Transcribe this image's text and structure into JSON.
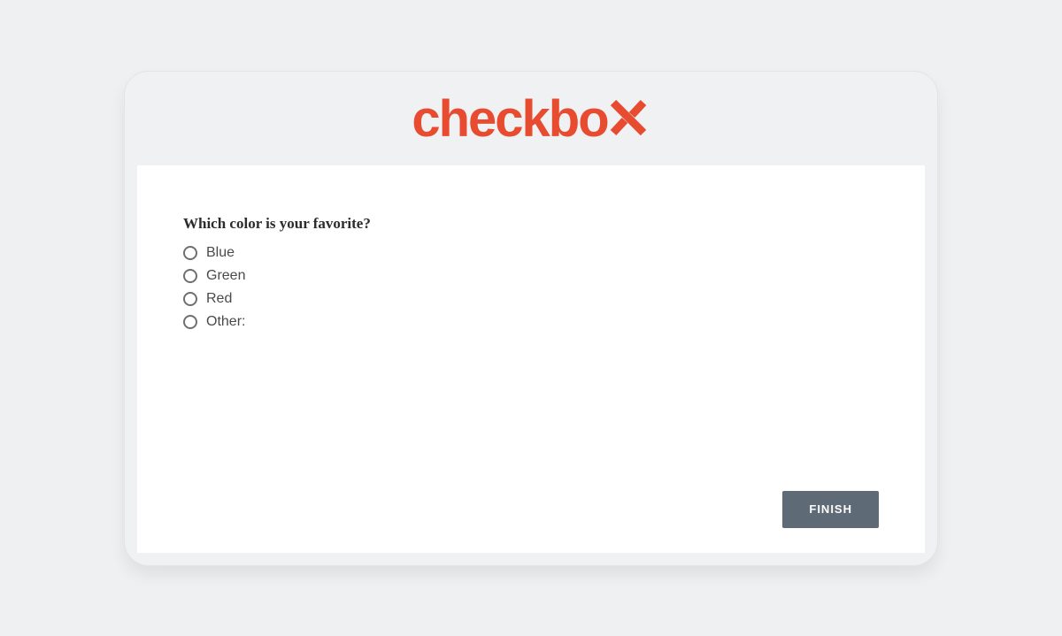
{
  "brand": {
    "name_prefix": "checkbo",
    "accent_color": "#e84c30"
  },
  "question": {
    "text": "Which color is your favorite?",
    "options": [
      {
        "label": "Blue"
      },
      {
        "label": "Green"
      },
      {
        "label": "Red"
      },
      {
        "label": "Other:"
      }
    ]
  },
  "actions": {
    "finish_label": "FINISH"
  },
  "colors": {
    "page_bg": "#eef0f2",
    "card_bg": "#eff1f3",
    "content_bg": "#ffffff",
    "button_bg": "#5e6b76"
  }
}
